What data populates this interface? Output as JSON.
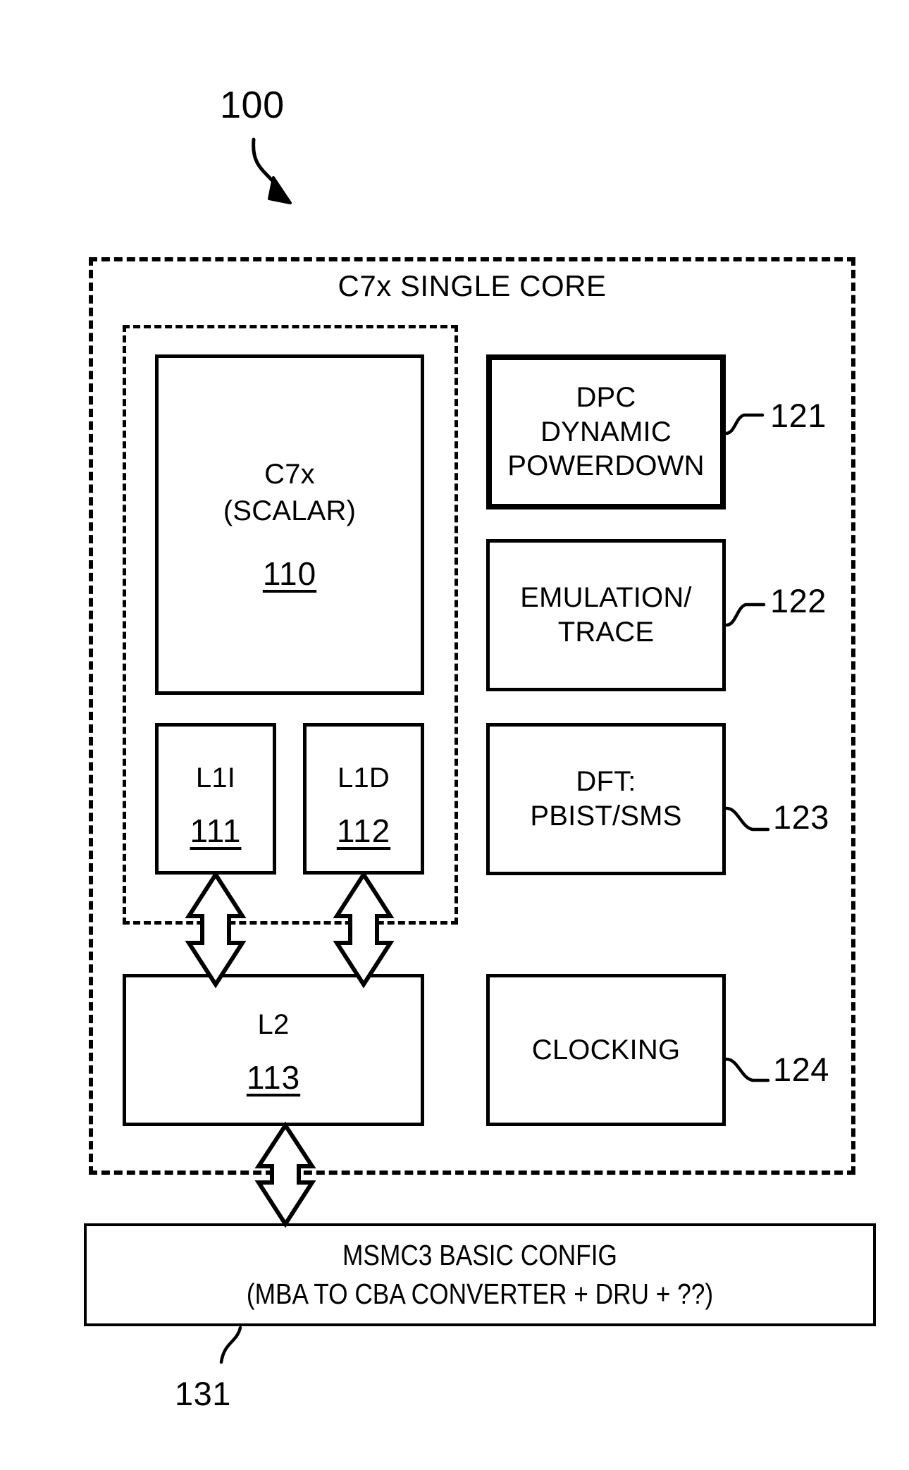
{
  "figure": {
    "top_reference": "100",
    "outer_title": "C7x SINGLE CORE"
  },
  "core": {
    "cpu": {
      "line1": "C7x",
      "line2": "(SCALAR)",
      "ref": "110"
    },
    "l1i": {
      "label": "L1I",
      "ref": "111"
    },
    "l1d": {
      "label": "L1D",
      "ref": "112"
    },
    "l2": {
      "label": "L2",
      "ref": "113"
    }
  },
  "peripherals": [
    {
      "label": "DPC\nDYNAMIC\nPOWERDOWN",
      "ref": "121"
    },
    {
      "label": "EMULATION/\nTRACE",
      "ref": "122"
    },
    {
      "label": "DFT:\nPBIST/SMS",
      "ref": "123"
    },
    {
      "label": "CLOCKING",
      "ref": "124"
    }
  ],
  "msmc": {
    "label": "MSMC3 BASIC CONFIG\n(MBA TO CBA CONVERTER + DRU + ??)",
    "ref": "131"
  },
  "colors": {
    "stroke": "#000000",
    "background": "#ffffff"
  }
}
